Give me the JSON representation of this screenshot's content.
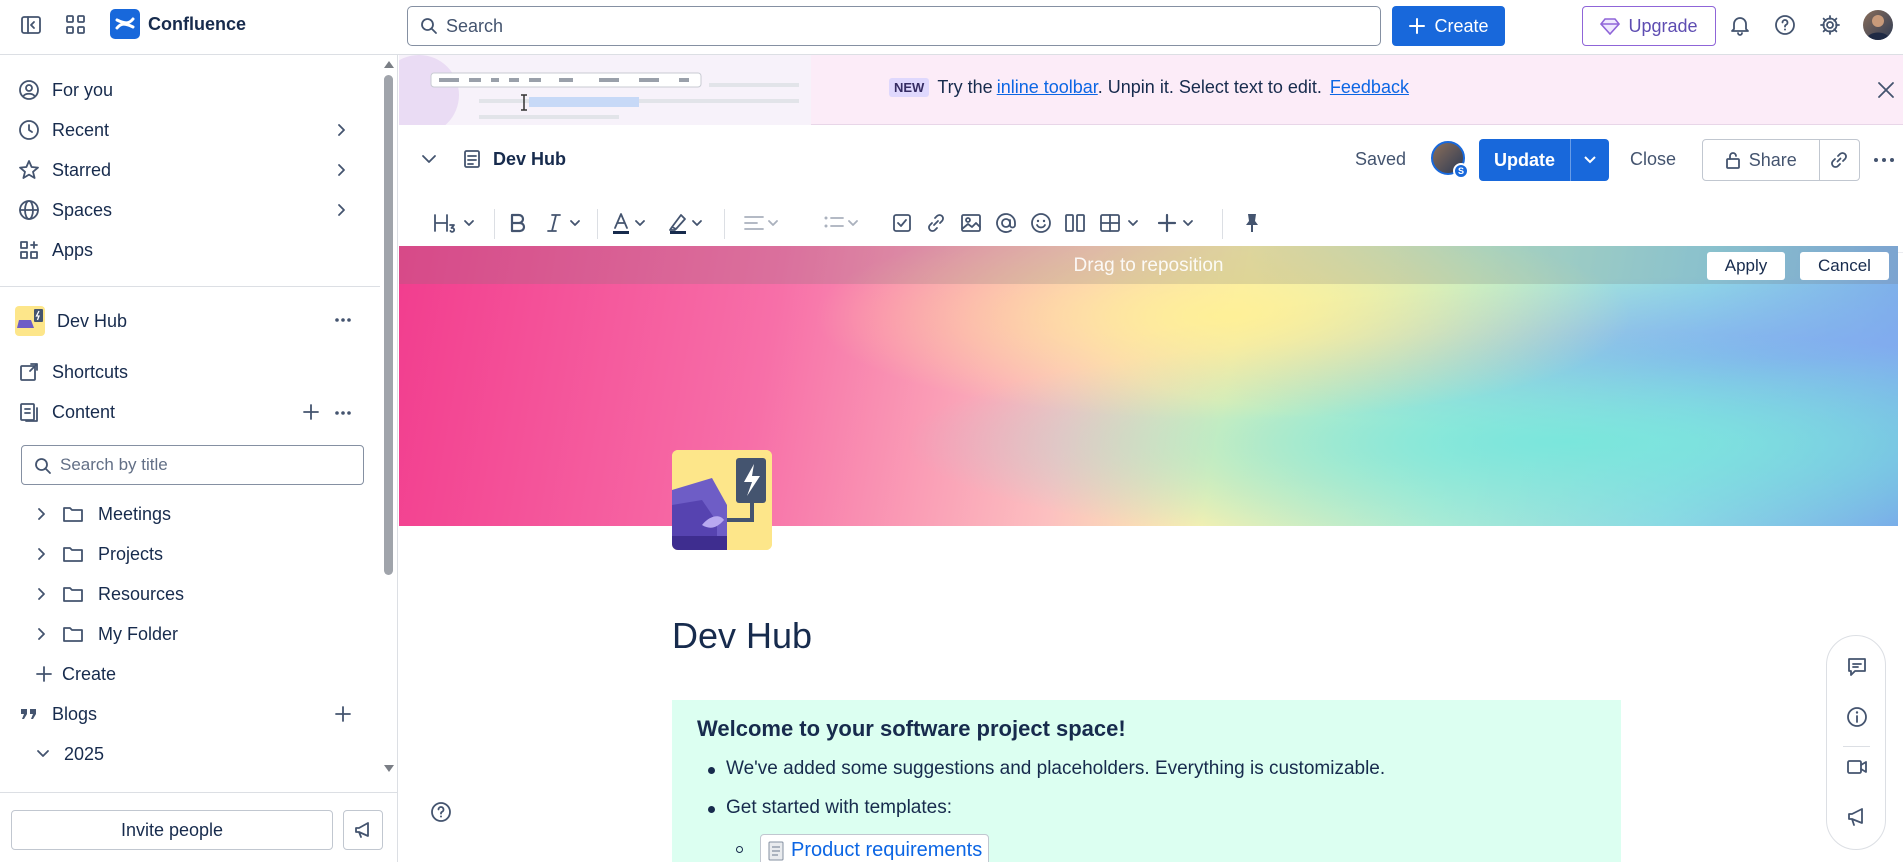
{
  "app": {
    "name": "Confluence"
  },
  "topbar": {
    "search_placeholder": "Search",
    "create_label": "Create",
    "upgrade_label": "Upgrade"
  },
  "sidebar": {
    "nav": [
      {
        "label": "For you",
        "icon": "person-circle-icon"
      },
      {
        "label": "Recent",
        "icon": "clock-icon"
      },
      {
        "label": "Starred",
        "icon": "star-icon"
      },
      {
        "label": "Spaces",
        "icon": "globe-icon"
      },
      {
        "label": "Apps",
        "icon": "apps-icon"
      }
    ],
    "space_name": "Dev Hub",
    "shortcuts_label": "Shortcuts",
    "content_label": "Content",
    "search_placeholder": "Search by title",
    "tree": [
      {
        "label": "Meetings"
      },
      {
        "label": "Projects"
      },
      {
        "label": "Resources"
      },
      {
        "label": "My Folder"
      }
    ],
    "create_label": "Create",
    "blogs_label": "Blogs",
    "year_label": "2025",
    "invite_label": "Invite people"
  },
  "banner": {
    "new_badge": "NEW",
    "text_before": "Try the",
    "link_text": "inline toolbar",
    "text_after": ". Unpin it. Select text to edit.",
    "feedback_link": "Feedback"
  },
  "page_header": {
    "title": "Dev Hub",
    "saved_label": "Saved",
    "update_label": "Update",
    "close_label": "Close",
    "share_label": "Share"
  },
  "cover": {
    "drag_text": "Drag to reposition",
    "apply_label": "Apply",
    "cancel_label": "Cancel"
  },
  "page": {
    "title": "Dev Hub",
    "panel_heading": "Welcome to your software project space!",
    "bullets": [
      "We've added some suggestions and placeholders. Everything is customizable.",
      "Get started with templates:"
    ],
    "template_link": "Product requirements"
  },
  "colors": {
    "brand_blue": "#1868db",
    "panel_bg": "#dcfff1",
    "banner_bg": "#fcecf8",
    "upgrade_purple": "#5e4db2"
  }
}
